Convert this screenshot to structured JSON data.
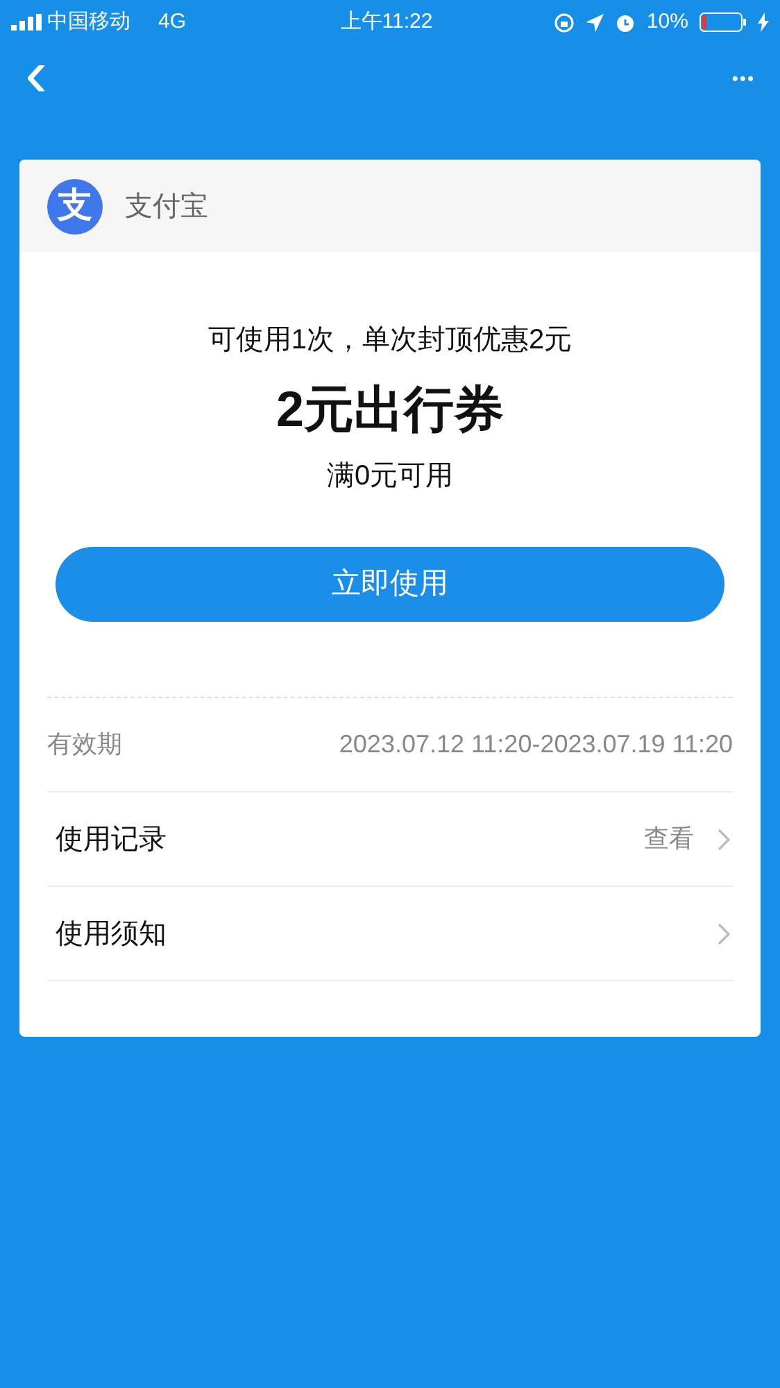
{
  "status_bar": {
    "carrier": "中国移动",
    "network": "4G",
    "time": "上午11:22",
    "battery": "10%"
  },
  "nav": {
    "back": "‹",
    "more": "•••"
  },
  "card": {
    "brand": {
      "logo_glyph": "支",
      "name": "支付宝"
    },
    "subtitle": "可使用1次，单次封顶优惠2元",
    "title": "2元出行券",
    "condition": "满0元可用",
    "button": "立即使用",
    "validity": {
      "label": "有效期",
      "value": "2023.07.12 11:20-2023.07.19 11:20"
    },
    "rows": [
      {
        "label": "使用记录",
        "action": "查看"
      },
      {
        "label": "使用须知"
      }
    ]
  }
}
